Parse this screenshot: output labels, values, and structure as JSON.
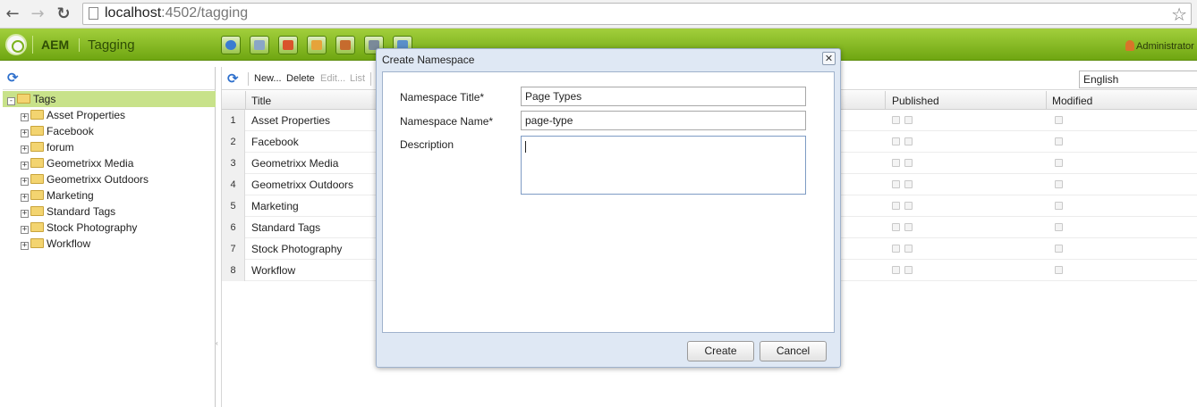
{
  "browser": {
    "url_host": "localhost",
    "url_path": ":4502/tagging"
  },
  "header": {
    "app_name": "AEM",
    "section": "Tagging",
    "user": "Administrator",
    "icons": [
      "websites-icon",
      "assets-icon",
      "campaigns-icon",
      "inbox-icon",
      "users-icon",
      "tools-icon",
      "tagging-icon"
    ]
  },
  "tree": {
    "root": "Tags",
    "items": [
      "Asset Properties",
      "Facebook",
      "forum",
      "Geometrixx Media",
      "Geometrixx Outdoors",
      "Marketing",
      "Standard Tags",
      "Stock Photography",
      "Workflow"
    ]
  },
  "grid": {
    "toolbar": {
      "new": "New...",
      "delete": "Delete",
      "edit": "Edit...",
      "list": "List"
    },
    "language": "English",
    "columns": {
      "title": "Title",
      "published": "Published",
      "modified": "Modified"
    },
    "rows": [
      {
        "num": "1",
        "title": "Asset Properties"
      },
      {
        "num": "2",
        "title": "Facebook"
      },
      {
        "num": "3",
        "title": "Geometrixx Media"
      },
      {
        "num": "4",
        "title": "Geometrixx Outdoors"
      },
      {
        "num": "5",
        "title": "Marketing"
      },
      {
        "num": "6",
        "title": "Standard Tags"
      },
      {
        "num": "7",
        "title": "Stock Photography"
      },
      {
        "num": "8",
        "title": "Workflow"
      }
    ]
  },
  "dialog": {
    "title": "Create Namespace",
    "fields": {
      "ns_title_label": "Namespace Title*",
      "ns_title_value": "Page Types",
      "ns_name_label": "Namespace Name*",
      "ns_name_value": "page-type",
      "description_label": "Description",
      "description_value": ""
    },
    "buttons": {
      "create": "Create",
      "cancel": "Cancel"
    }
  },
  "colors": {
    "header_green": "#7fb51f",
    "selection_green": "#c8e28a",
    "dialog_frame": "#dfe8f4"
  }
}
